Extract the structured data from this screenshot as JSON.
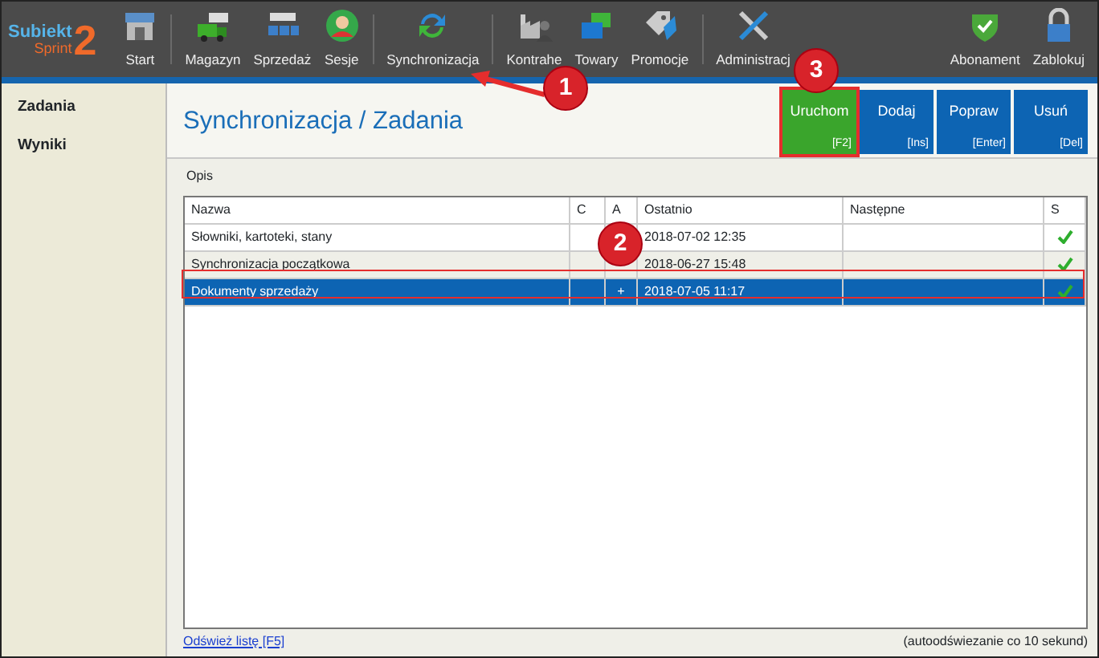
{
  "logo": {
    "title": "Subiekt",
    "subtitle": "Sprint",
    "number": "2"
  },
  "toolbar_groups": [
    [
      "Start"
    ],
    [
      "Magazyn",
      "Sprzedaż",
      "Sesje"
    ],
    [
      "Synchronizacja"
    ],
    [
      "Kontrahe",
      "Towary",
      "Promocje"
    ],
    [
      "Administracj"
    ]
  ],
  "toolbar_right": [
    "Abonament",
    "Zablokuj"
  ],
  "sidebar": [
    "Zadania",
    "Wyniki"
  ],
  "page_title": "Synchronizacja / Zadania",
  "actions": [
    {
      "label": "Uruchom",
      "shortcut": "[F2]",
      "kind": "run"
    },
    {
      "label": "Dodaj",
      "shortcut": "[Ins]",
      "kind": "normal"
    },
    {
      "label": "Popraw",
      "shortcut": "[Enter]",
      "kind": "normal"
    },
    {
      "label": "Usuń",
      "shortcut": "[Del]",
      "kind": "normal"
    }
  ],
  "caption": "Opis",
  "table": {
    "columns": [
      "Nazwa",
      "C",
      "A",
      "Ostatnio",
      "Następne",
      "S"
    ],
    "rows": [
      {
        "name": "Słowniki, kartoteki, stany",
        "last": "2018-07-02 12:35",
        "ok": true,
        "selected": false
      },
      {
        "name": "Synchronizacja początkowa",
        "last": "2018-06-27 15:48",
        "ok": true,
        "selected": false
      },
      {
        "name": "Dokumenty sprzedaży",
        "a": "+",
        "last": "2018-07-05 11:17",
        "ok": true,
        "selected": true
      }
    ]
  },
  "refresh_link": "Odśwież listę [F5]",
  "refresh_note": "(autoodświezanie co 10 sekund)",
  "callouts": [
    "1",
    "2",
    "3"
  ]
}
